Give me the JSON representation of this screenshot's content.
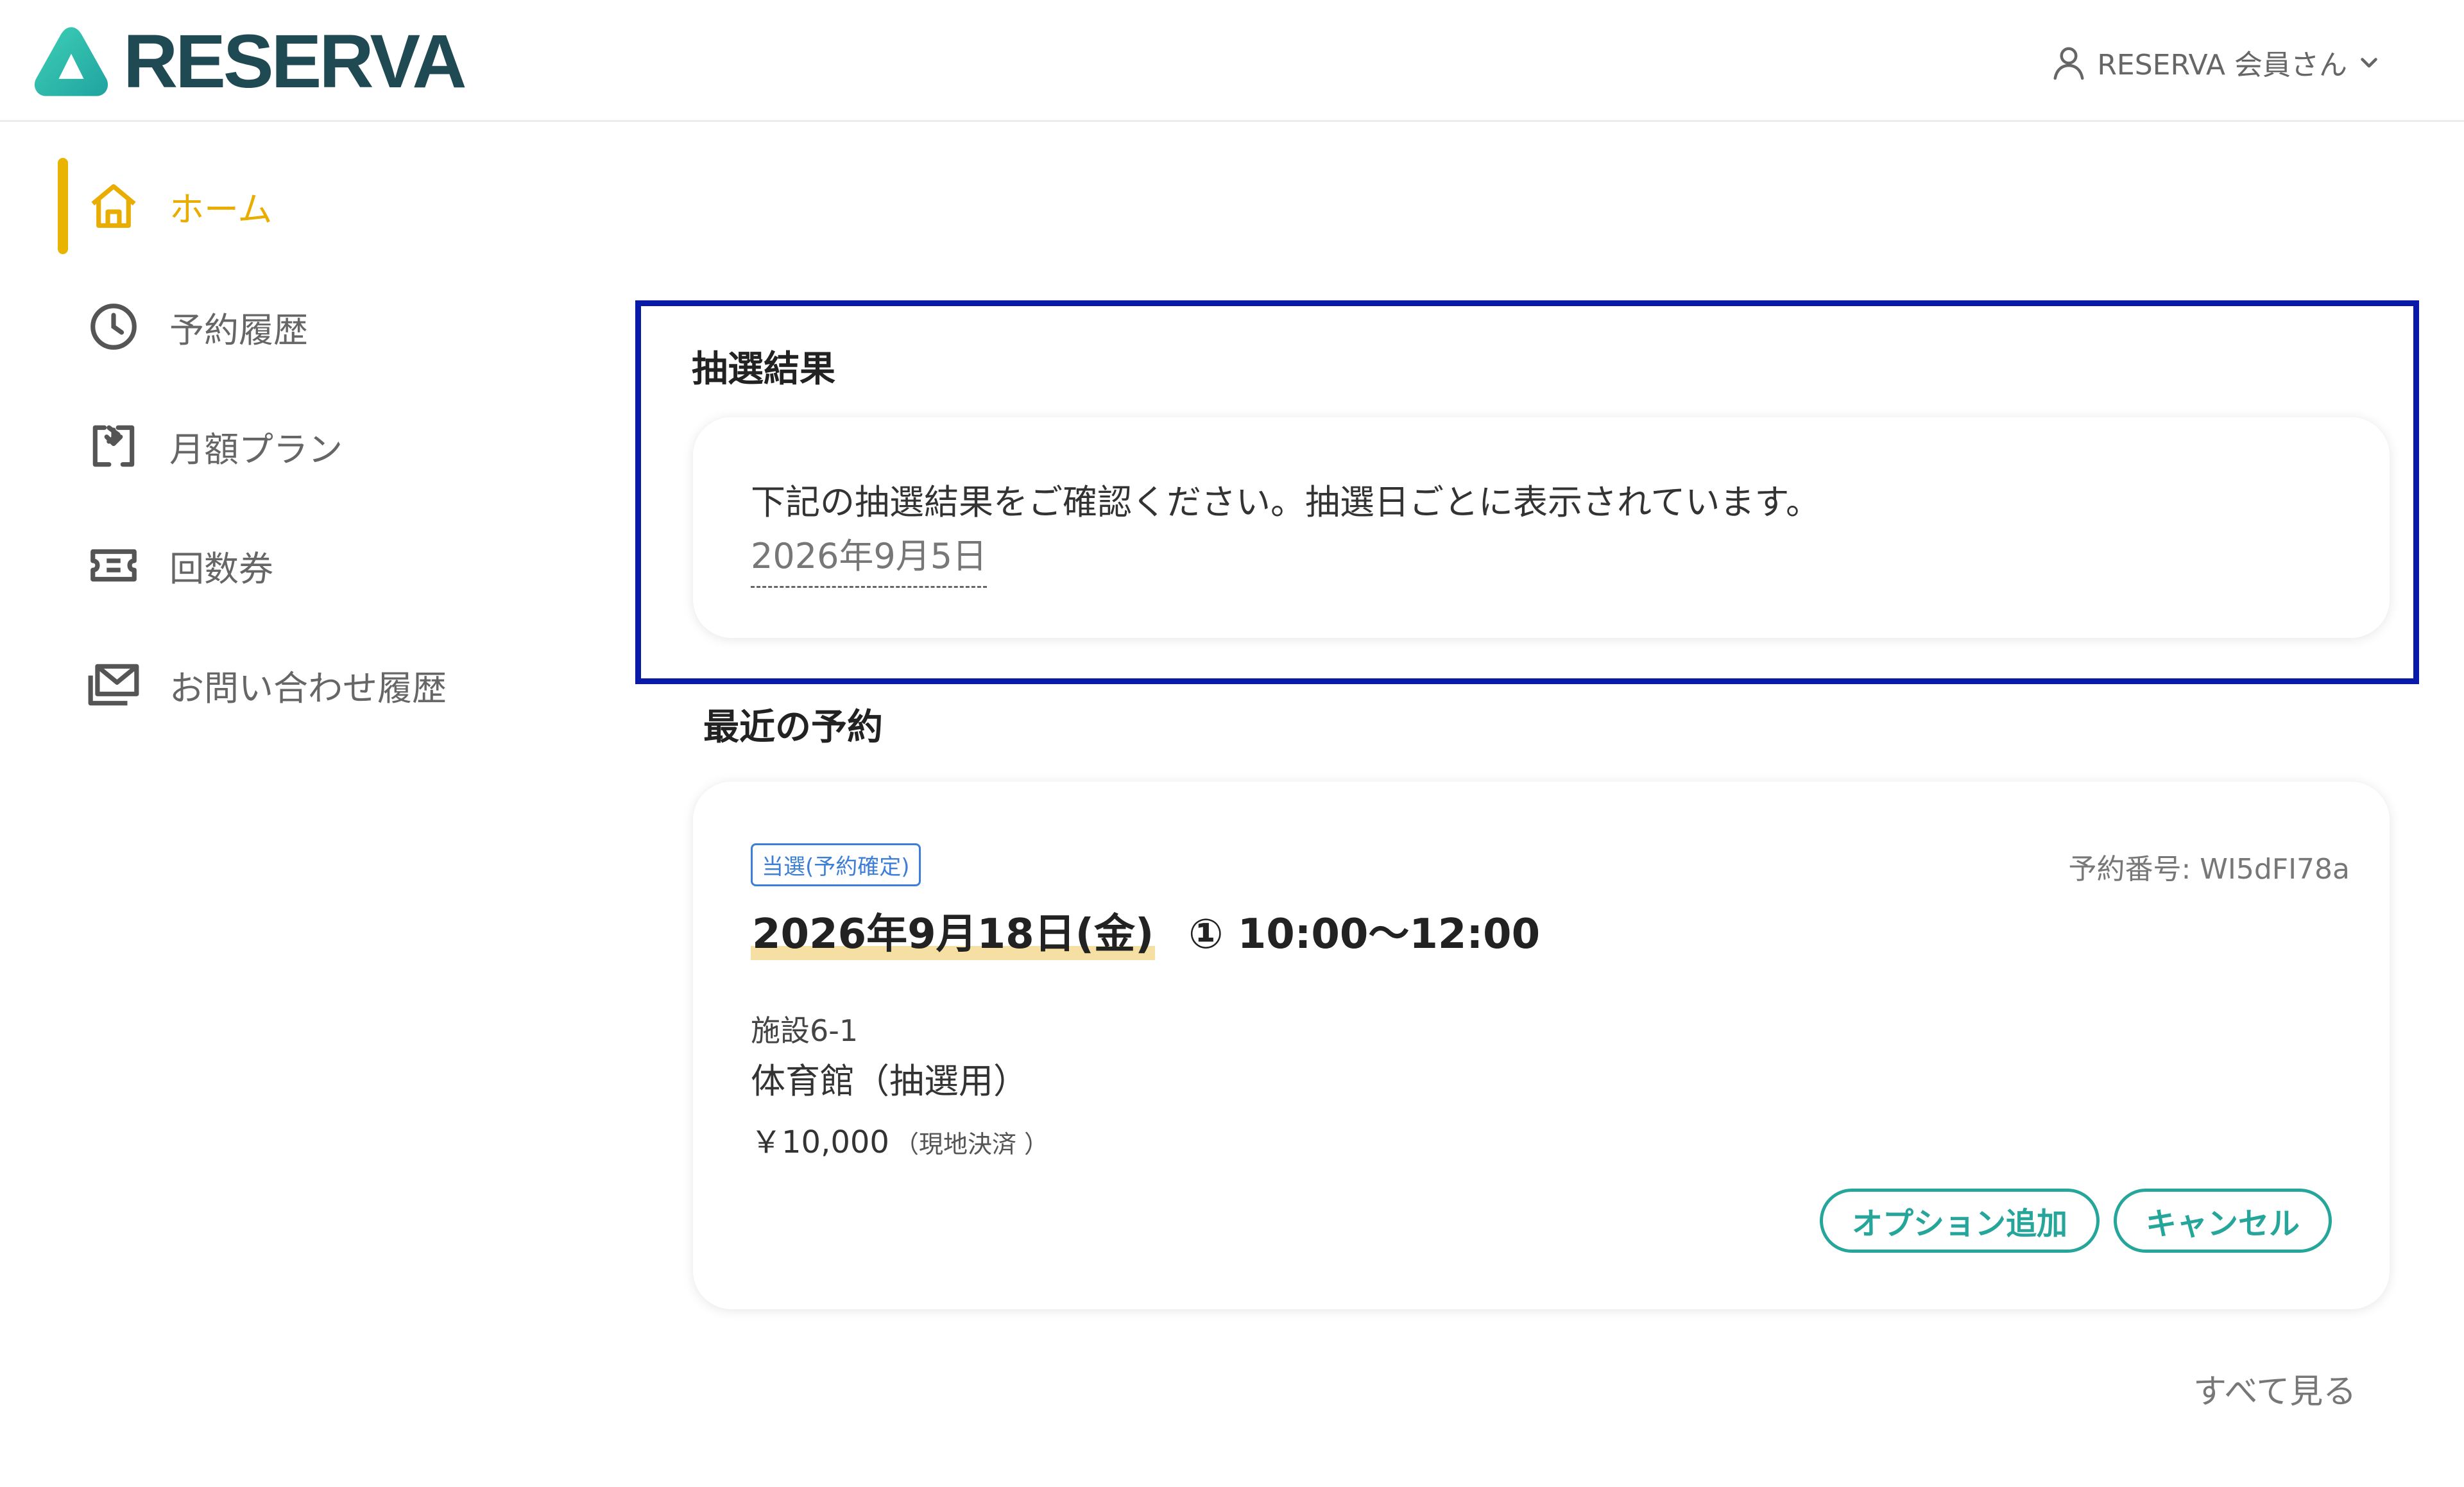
{
  "header": {
    "logo_text": "RESERVA",
    "user_label": "RESERVA 会員さん",
    "icons": {
      "user": "user-icon",
      "dropdown": "chevron-down-icon"
    }
  },
  "colors": {
    "brand_teal": "#26a69a",
    "brand_dark": "#1f4a53",
    "active_nav": "#e8ad00",
    "highlight_border": "#0a1aa8",
    "badge_blue": "#3d7fd6",
    "date_marker": "#f6dfa3"
  },
  "sidebar": {
    "items": [
      {
        "label": "ホーム",
        "icon": "home-icon",
        "active": true
      },
      {
        "label": "予約履歴",
        "icon": "clock-icon",
        "active": false
      },
      {
        "label": "月額プラン",
        "icon": "repeat-icon",
        "active": false
      },
      {
        "label": "回数券",
        "icon": "ticket-icon",
        "active": false
      },
      {
        "label": "お問い合わせ履歴",
        "icon": "mail-icon",
        "active": false
      }
    ]
  },
  "lottery": {
    "title": "抽選結果",
    "description": "下記の抽選結果をご確認ください。抽選日ごとに表示されています。",
    "date_link": "2026年9月5日"
  },
  "recent": {
    "title": "最近の予約",
    "reservation": {
      "status": "当選(予約確定)",
      "number": "予約番号: WI5dFI78a",
      "date": "2026年9月18日(金)",
      "slot": "① 10:00〜12:00",
      "facility_code": "施設6-1",
      "facility_name": "体育館（抽選用）",
      "price": "￥10,000",
      "price_note": "（現地決済 ）",
      "buttons": {
        "option": "オプション追加",
        "cancel": "キャンセル"
      }
    },
    "see_all": "すべて見る"
  }
}
